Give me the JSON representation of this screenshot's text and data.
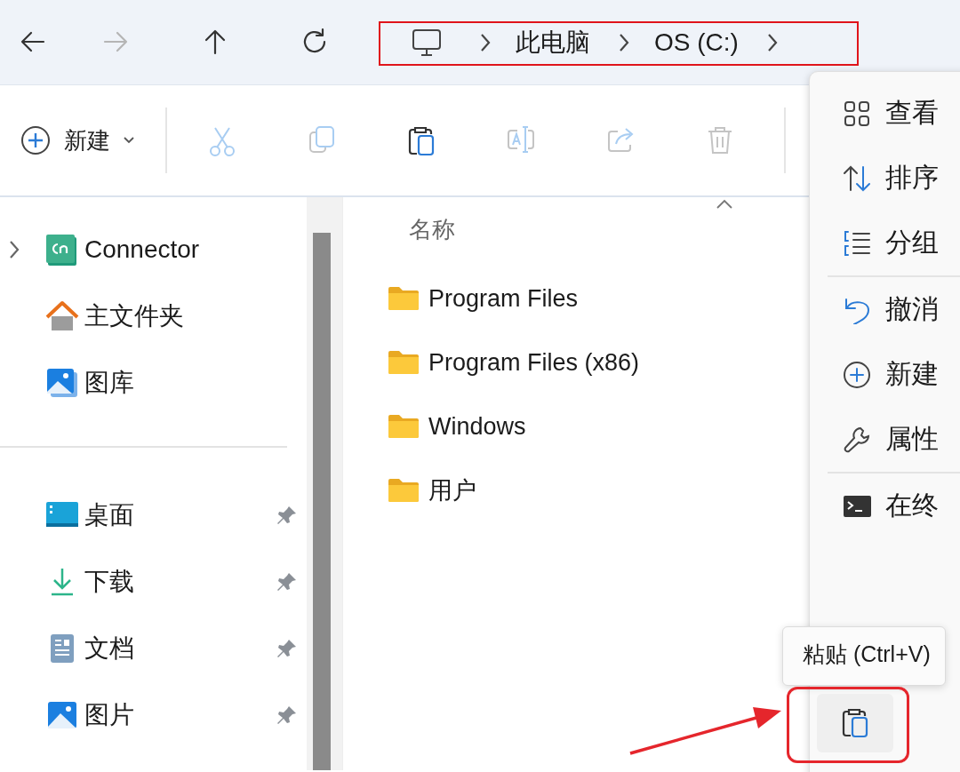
{
  "nav": {
    "buttons": [
      {
        "kind": "back",
        "disabled": false
      },
      {
        "kind": "forward",
        "disabled": true
      },
      {
        "kind": "up",
        "disabled": false
      },
      {
        "kind": "refresh",
        "disabled": false
      }
    ]
  },
  "address_bar": {
    "highlighted": true,
    "segments": [
      "此电脑",
      "OS (C:)"
    ]
  },
  "toolbar": {
    "new_button": "新建",
    "items": [
      {
        "kind": "cut",
        "disabled": true
      },
      {
        "kind": "copy",
        "disabled": true
      },
      {
        "kind": "paste",
        "disabled": false
      },
      {
        "kind": "rename",
        "disabled": true
      },
      {
        "kind": "share",
        "disabled": true
      },
      {
        "kind": "delete",
        "disabled": true
      }
    ]
  },
  "sidebar": {
    "items": [
      {
        "kind": "connector",
        "label": "Connector",
        "expandable": true
      },
      {
        "kind": "home",
        "label": "主文件夹",
        "expandable": false
      },
      {
        "kind": "gallery",
        "label": "图库",
        "expandable": false
      }
    ],
    "quick_access": [
      {
        "kind": "desktop",
        "label": "桌面",
        "pinned": true
      },
      {
        "kind": "download",
        "label": "下载",
        "pinned": true
      },
      {
        "kind": "document",
        "label": "文档",
        "pinned": true
      },
      {
        "kind": "picture",
        "label": "图片",
        "pinned": true
      }
    ]
  },
  "file_list": {
    "column": {
      "label": "名称",
      "sorted": true
    },
    "rows": [
      {
        "name": "Program Files"
      },
      {
        "name": "Program Files (x86)"
      },
      {
        "name": "Windows"
      },
      {
        "name": "用户"
      }
    ]
  },
  "context_menu": {
    "groups": [
      [
        {
          "kind": "view",
          "label": "查看"
        },
        {
          "kind": "sort",
          "label": "排序"
        },
        {
          "kind": "group",
          "label": "分组"
        }
      ],
      [
        {
          "kind": "undo",
          "label": "撤消"
        },
        {
          "kind": "new",
          "label": "新建"
        },
        {
          "kind": "properties",
          "label": "属性"
        }
      ],
      [
        {
          "kind": "terminal",
          "label": "在终"
        }
      ]
    ]
  },
  "paste_tooltip": "粘贴 (Ctrl+V)",
  "paste_button": {
    "highlighted": true
  }
}
